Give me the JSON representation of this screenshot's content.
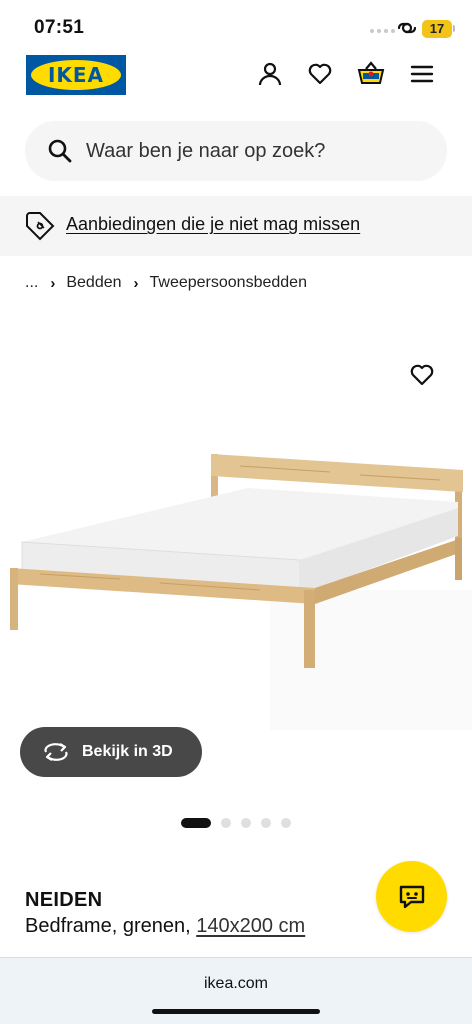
{
  "status": {
    "time": "07:51",
    "battery": "17"
  },
  "header": {
    "logo_text": "IKEA",
    "icons": [
      "profile-icon",
      "wishlist-heart-icon",
      "shopping-basket-icon",
      "menu-icon"
    ]
  },
  "search": {
    "placeholder": "Waar ben je naar op zoek?"
  },
  "promo": {
    "text": "Aanbiedingen die je niet mag missen",
    "icon": "price-tag-icon"
  },
  "breadcrumb": {
    "items": [
      "...",
      "Bedden",
      "Tweepersoonsbedden"
    ]
  },
  "gallery": {
    "view_3d_label": "Bekijk in 3D",
    "image_count": 5,
    "active_index": 0
  },
  "product": {
    "name": "NEIDEN",
    "description": "Bedframe, grenen, ",
    "size": "140x200 cm"
  },
  "browser": {
    "url": "ikea.com"
  },
  "colors": {
    "ikea_blue": "#0058a3",
    "ikea_yellow": "#ffdb00",
    "dark_button": "#484848"
  }
}
